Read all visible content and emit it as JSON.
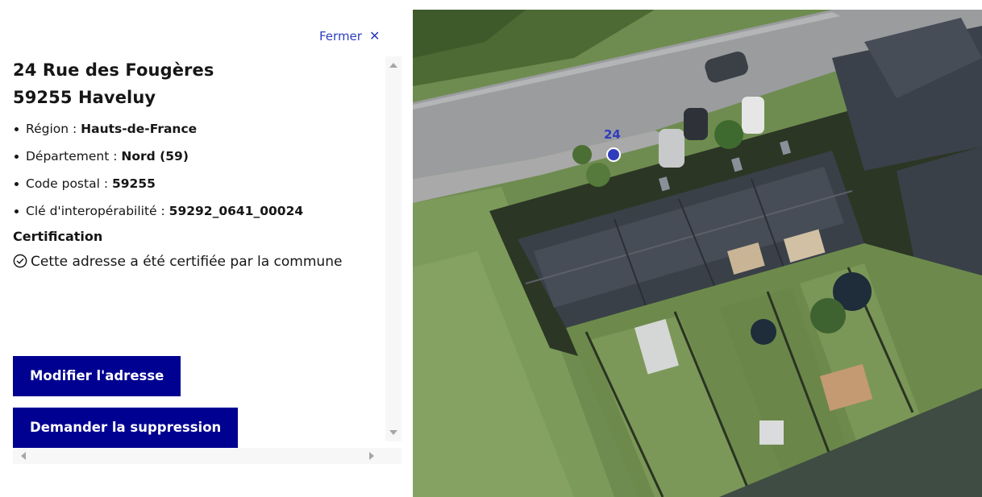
{
  "panel": {
    "close_label": "Fermer",
    "close_icon": "close-icon",
    "address_line1": "24 Rue des Fougères",
    "address_line2": "59255 Haveluy",
    "info": [
      {
        "label": "Région : ",
        "value": "Hauts-de-France"
      },
      {
        "label": "Département : ",
        "value": "Nord (59)"
      },
      {
        "label": "Code postal : ",
        "value": "59255"
      },
      {
        "label": "Clé d'interopérabilité : ",
        "value": "59292_0641_00024"
      }
    ],
    "certification_title": "Certification",
    "certification_text": "Cette adresse a été certifiée par la commune",
    "certification_icon": "check-circle-icon",
    "edit_button": "Modifier l'adresse",
    "delete_button": "Demander la suppression"
  },
  "map": {
    "marker_label": "24",
    "marker_icon": "location-dot-icon"
  },
  "colors": {
    "primary": "#000091",
    "link": "#2f3dbd",
    "marker": "#2f3dbd"
  }
}
